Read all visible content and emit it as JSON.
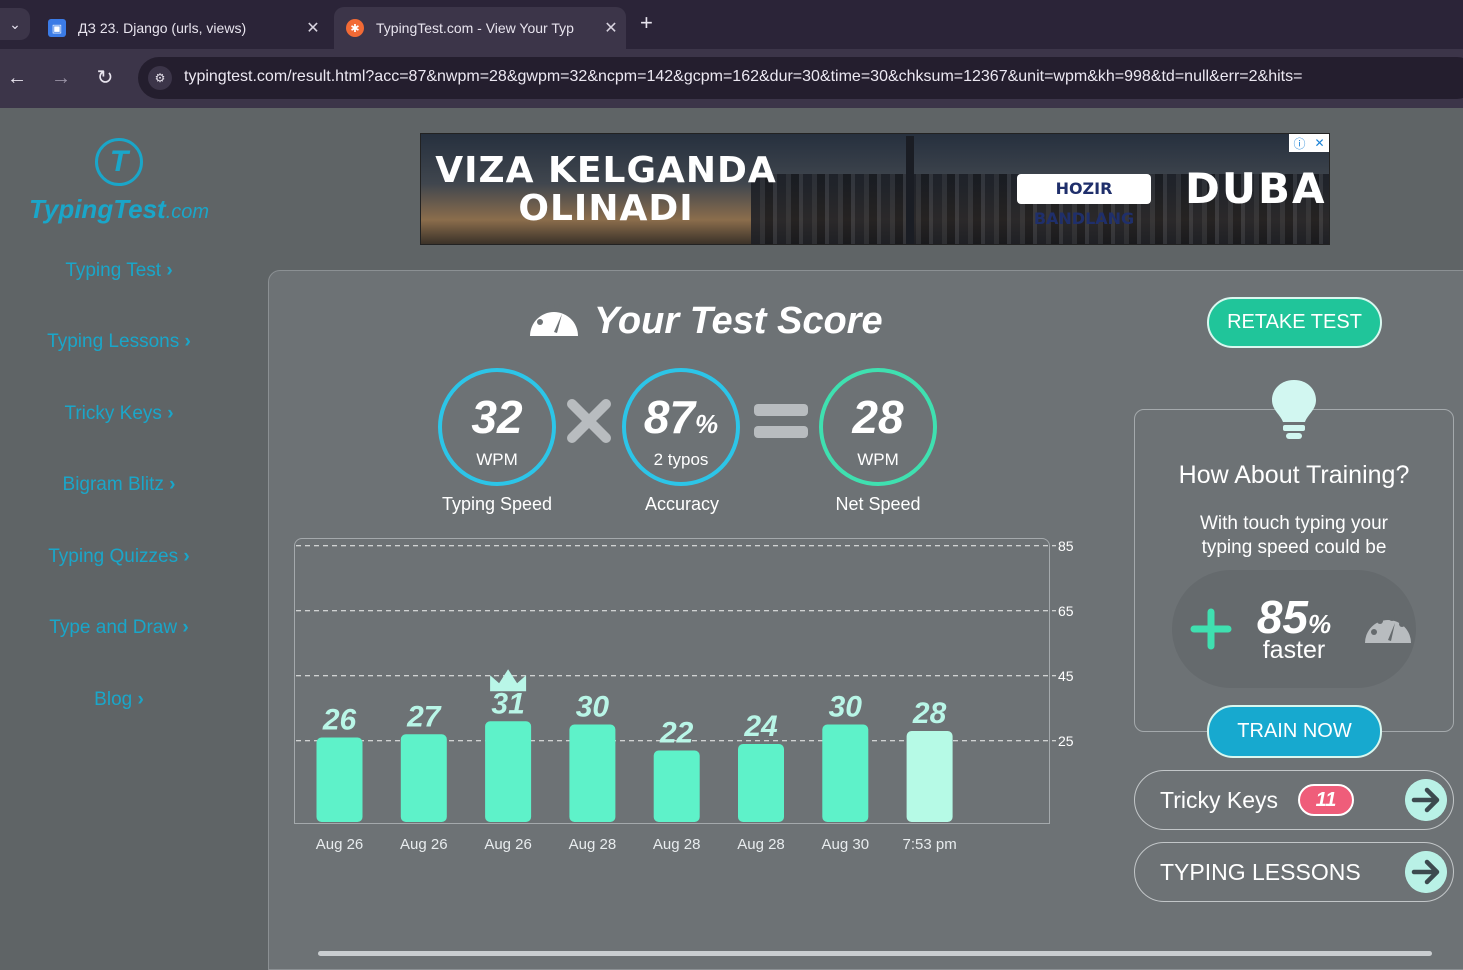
{
  "browser": {
    "tabs": [
      {
        "title": "ДЗ 23. Django (urls, views)",
        "active": false
      },
      {
        "title": "TypingTest.com - View Your Typ",
        "active": true
      }
    ],
    "url": "typingtest.com/result.html?acc=87&nwpm=28&gwpm=32&ncpm=142&gcpm=162&dur=30&time=30&chksum=12367&unit=wpm&kh=998&td=null&err=2&hits="
  },
  "sidebar": {
    "logo": "TypingTest",
    "logo_suffix": ".com",
    "items": [
      {
        "label": "Typing Test"
      },
      {
        "label": "Typing Lessons"
      },
      {
        "label": "Tricky Keys"
      },
      {
        "label": "Bigram Blitz"
      },
      {
        "label": "Typing Quizzes"
      },
      {
        "label": "Type and Draw"
      },
      {
        "label": "Blog"
      }
    ]
  },
  "ad": {
    "headline_1": "VIZA KELGANDA",
    "headline_2": "OLINADI",
    "badge": "HOZIR BANDLANG",
    "brand": "DUBAI"
  },
  "score": {
    "title": "Your Test Score",
    "gross": {
      "value": "32",
      "unit": "WPM",
      "label": "Typing Speed"
    },
    "accuracy": {
      "value": "87",
      "unit": "%",
      "sub": "2 typos",
      "label": "Accuracy"
    },
    "net": {
      "value": "28",
      "unit": "WPM",
      "label": "Net Speed"
    }
  },
  "chart_data": {
    "type": "bar",
    "categories": [
      "Aug 26",
      "Aug 26",
      "Aug 26",
      "Aug 28",
      "Aug 28",
      "Aug 28",
      "Aug 30",
      "7:53 pm"
    ],
    "values": [
      26,
      27,
      31,
      30,
      22,
      24,
      30,
      28
    ],
    "best_index": 2,
    "y_ticks": [
      85,
      65,
      45,
      25
    ],
    "ylim": [
      0,
      85
    ],
    "grid": true,
    "colors": {
      "bar": "#5ef2c9",
      "current": "#b6fae6",
      "label": "#b9f6e7"
    }
  },
  "actions": {
    "retake": "RETAKE TEST",
    "train_title": "How About Training?",
    "train_text": "With touch typing your typing speed could be",
    "faster_value": "85",
    "faster_unit": "%",
    "faster_word": "faster",
    "train_now": "TRAIN NOW",
    "tricky_keys": "Tricky Keys",
    "tricky_count": "11",
    "lessons": "TYPING LESSONS"
  }
}
